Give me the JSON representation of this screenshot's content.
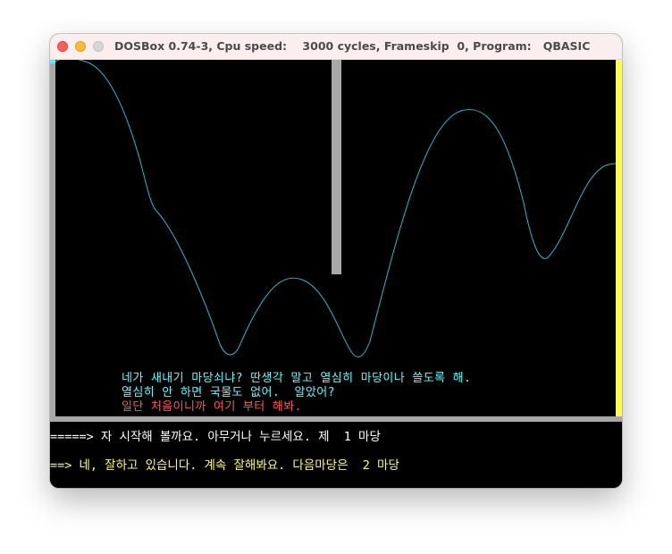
{
  "window": {
    "title": "DOSBox 0.74-3, Cpu speed:    3000 cycles, Frameskip  0, Program:   QBASIC"
  },
  "game": {
    "messages": [
      "네가 새내기 마당쇠냐? 딴생각 말고 열심히 마당이나 쓸도록 해.",
      "열심히 안 하면 국물도 없어.  알았어?",
      "일단 처음이니까 여기 부터 해봐."
    ],
    "message_colors": [
      "#55ffff",
      "#55ffff",
      "#ff5555"
    ],
    "terrain_color": "#22bbcc",
    "frame_color": "#a8a8a8",
    "right_border_color": "#ffff3a"
  },
  "console": {
    "line1": "=====> 자 시작해 볼까요. 아무거나 누르세요. 제  1 마당",
    "line2": "==> 네, 잘하고 있습니다. 계속 잘해봐요. 다음마당은  2 마당",
    "line1_color": "#ffffff",
    "line2_color": "#ffff55"
  }
}
